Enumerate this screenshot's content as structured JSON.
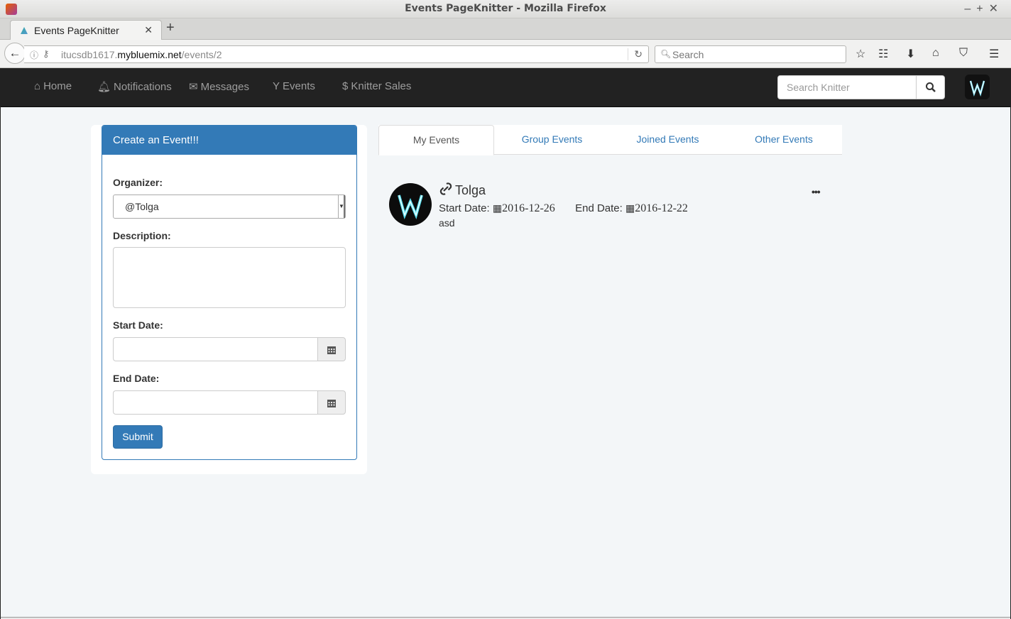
{
  "window": {
    "title": "Events PageKnitter - Mozilla Firefox"
  },
  "browser": {
    "tab_title": "Events PageKnitter",
    "url_prefix": "itucsdb1617.",
    "url_domain": "mybluemix.net",
    "url_path": "/events/2",
    "search_placeholder": "Search"
  },
  "app_nav": {
    "items": [
      {
        "label": "Home",
        "icon": "home-icon"
      },
      {
        "label": "Notifications",
        "icon": "bell-icon"
      },
      {
        "label": "Messages",
        "icon": "envelope-icon"
      },
      {
        "label": "Events",
        "icon": "filter-icon"
      },
      {
        "label": "Knitter Sales",
        "icon": "dollar-icon"
      }
    ],
    "search_placeholder": "Search Knitter"
  },
  "form": {
    "heading": "Create an Event!!!",
    "organizer_label": "Organizer:",
    "organizer_value": "@Tolga",
    "description_label": "Description:",
    "start_label": "Start Date:",
    "end_label": "End Date:",
    "submit_label": "Submit"
  },
  "tabs": [
    "My Events",
    "Group Events",
    "Joined Events",
    "Other Events"
  ],
  "event": {
    "name": "Tolga",
    "start_label": "Start Date:",
    "start_value": "2016-12-26",
    "end_label": "End Date:",
    "end_value": "2016-12-22",
    "description": "asd",
    "more": "•••"
  },
  "colors": {
    "primary": "#337ab7",
    "navbar": "#222222",
    "page_bg": "#f3f6f8"
  }
}
